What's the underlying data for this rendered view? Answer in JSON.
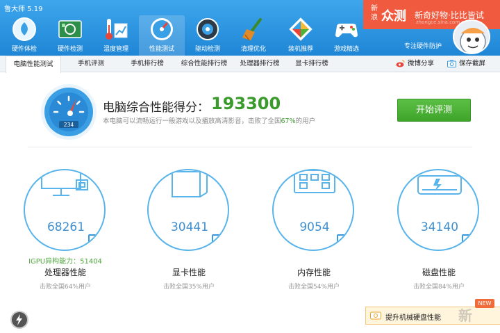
{
  "app": {
    "title": "鲁大师 5.19"
  },
  "nav": {
    "items": [
      {
        "label": "硬件体检",
        "icon": "hardware-check-icon"
      },
      {
        "label": "硬件检测",
        "icon": "hardware-detect-icon"
      },
      {
        "label": "温度管理",
        "icon": "temperature-icon"
      },
      {
        "label": "性能测试",
        "icon": "performance-gauge-icon",
        "active": true
      },
      {
        "label": "驱动检测",
        "icon": "driver-icon"
      },
      {
        "label": "清理优化",
        "icon": "broom-icon"
      },
      {
        "label": "装机推荐",
        "icon": "cube-icon"
      },
      {
        "label": "游戏精选",
        "icon": "gamepad-icon"
      }
    ]
  },
  "promo": {
    "logo": "新浪",
    "brand": "众测",
    "slogan": "新奇好物·比比皆试",
    "site": "zhongce.sina.com.cn"
  },
  "guard": {
    "label": "专注硬件防护"
  },
  "tabs": [
    {
      "label": "电脑性能测试",
      "active": true
    },
    {
      "label": "手机评测"
    },
    {
      "label": "手机排行榜"
    },
    {
      "label": "综合性能排行榜"
    },
    {
      "label": "处理器排行榜"
    },
    {
      "label": "显卡排行榜"
    }
  ],
  "tab_actions": {
    "share": "微博分享",
    "screenshot": "保存截屏"
  },
  "score": {
    "label": "电脑综合性能得分：",
    "value": "193300",
    "desc_prefix": "本电脑可以流畅运行一般游戏以及播放高清影音，击败了全国",
    "desc_pct": "67%",
    "desc_suffix": "的用户",
    "gauge_readout": "234"
  },
  "start_button": "开始评测",
  "categories": [
    {
      "value": "68261",
      "name": "处理器性能",
      "sub": "击败全国64%用户",
      "extra": "IGPU异构能力：51404"
    },
    {
      "value": "30441",
      "name": "显卡性能",
      "sub": "击败全国35%用户"
    },
    {
      "value": "9054",
      "name": "内存性能",
      "sub": "击败全国54%用户"
    },
    {
      "value": "34140",
      "name": "磁盘性能",
      "sub": "击败全国84%用户"
    }
  ],
  "bottom": {
    "banner_text": "提升机械硬盘性能",
    "new_badge": "NEW",
    "watermark": "新"
  },
  "colors": {
    "accent": "#1f86d6",
    "score_green": "#3a9a2c",
    "button_green": "#4db13a",
    "ring_blue": "#58b4ea",
    "promo_red": "#f05b3f"
  }
}
